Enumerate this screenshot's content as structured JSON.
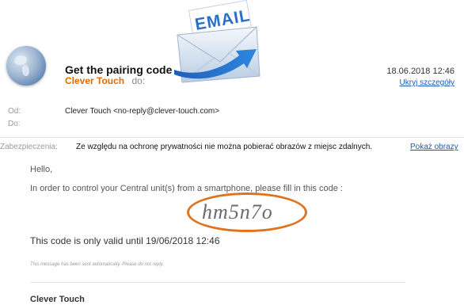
{
  "header": {
    "subject": "Get the pairing code",
    "sender_name": "Clever Touch",
    "to_label": "do:",
    "date": "18.06.2018 12:46",
    "hide_details": "Ukryj szczegóły"
  },
  "envelope": {
    "label": "EMAIL"
  },
  "meta": {
    "from_label": "Od:",
    "from_value": "Clever Touch <no-reply@clever-touch.com>",
    "to_label": "Do:",
    "security_label": "Zabezpieczenia:",
    "security_message": "Ze względu na ochronę prywatności nie można pobierać obrazów z miejsc zdalnych.",
    "show_images": "Pokaż obrazy"
  },
  "body": {
    "greeting": "Hello,",
    "instruction": "In order to control your Central unit(s) from a smartphone, please fill in this code :",
    "code": "hm5n7o",
    "validity": "This code is only valid until 19/06/2018 12:46",
    "auto_note": "This message has been sent automatically. Please do not reply.",
    "signature": "Clever Touch"
  },
  "colors": {
    "accent_orange": "#e26b00",
    "link_blue": "#1a58b8",
    "highlight_ring": "#e0731f"
  }
}
